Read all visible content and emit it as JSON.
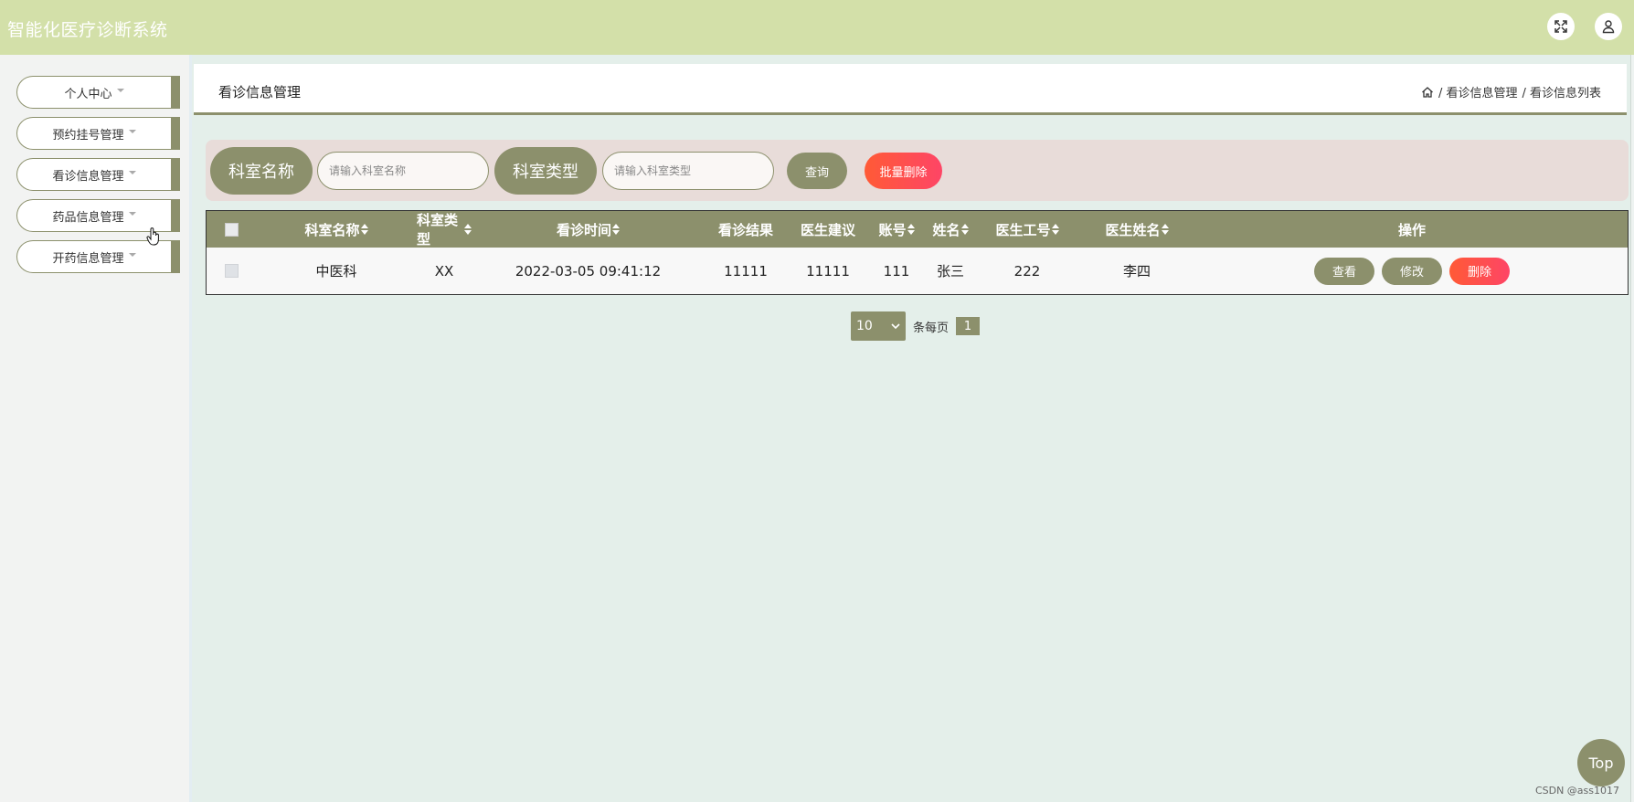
{
  "header": {
    "app_title": "智能化医疗诊断系统",
    "fullscreen_icon": "fullscreen-icon",
    "user_icon": "user-icon"
  },
  "sidebar": {
    "items": [
      {
        "label": "个人中心"
      },
      {
        "label": "预约挂号管理"
      },
      {
        "label": "看诊信息管理"
      },
      {
        "label": "药品信息管理"
      },
      {
        "label": "开药信息管理"
      }
    ]
  },
  "page": {
    "title": "看诊信息管理",
    "breadcrumb": [
      {
        "label": "/ 看诊信息管理"
      },
      {
        "label": "/ 看诊信息列表"
      }
    ]
  },
  "search": {
    "label_dept_name": "科室名称",
    "placeholder_dept_name": "请输入科室名称",
    "label_dept_type": "科室类型",
    "placeholder_dept_type": "请输入科室类型",
    "query_label": "查询",
    "batch_delete_label": "批量删除"
  },
  "table": {
    "columns": [
      "科室名称",
      "科室类型",
      "看诊时间",
      "看诊结果",
      "医生建议",
      "账号",
      "姓名",
      "医生工号",
      "医生姓名",
      "操作"
    ],
    "rows": [
      {
        "dept_name": "中医科",
        "dept_type": "XX",
        "visit_time": "2022-03-05 09:41:12",
        "result": "11111",
        "advice": "11111",
        "account": "111",
        "name": "张三",
        "doctor_id": "222",
        "doctor_name": "李四",
        "actions": {
          "view": "查看",
          "edit": "修改",
          "delete": "删除"
        }
      }
    ]
  },
  "pager": {
    "page_size": "10",
    "per_page_label": "条每页",
    "current_page": "1"
  },
  "top_button": "Top",
  "watermark": "CSDN @ass1017",
  "colors": {
    "header_bg": "#d3e0a9",
    "accent": "#8c906c",
    "danger": "#fe4566",
    "page_bg": "#e4efea",
    "search_bg": "#e8dcd9"
  }
}
